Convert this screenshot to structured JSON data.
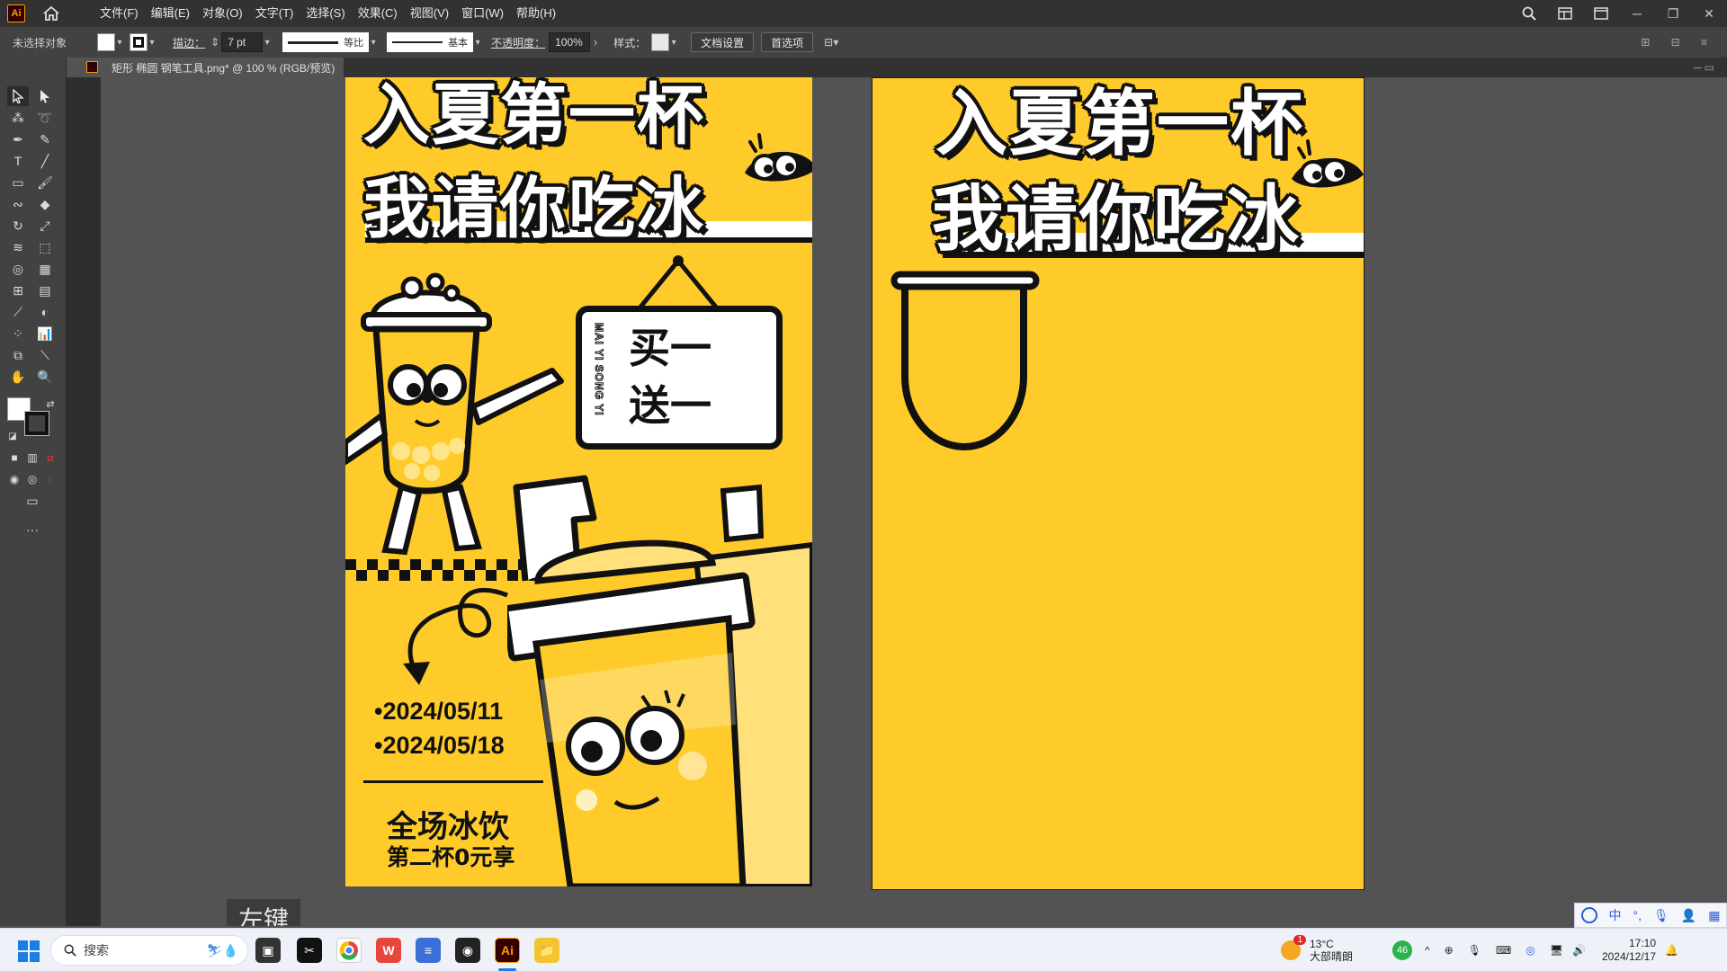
{
  "app": {
    "logo": "Ai",
    "menus": [
      "文件(F)",
      "编辑(E)",
      "对象(O)",
      "文字(T)",
      "选择(S)",
      "效果(C)",
      "视图(V)",
      "窗口(W)",
      "帮助(H)"
    ]
  },
  "controlbar": {
    "selection": "未选择对象",
    "stroke_label": "描边：",
    "stroke_value": "7 pt",
    "stroke_profile": "等比",
    "brush": "基本",
    "opacity_label": "不透明度：",
    "opacity_value": "100%",
    "style_label": "样式：",
    "doc_settings": "文档设置",
    "preferences": "首选项"
  },
  "document": {
    "tab_title": "矩形 椭圆 钢笔工具.png* @ 100 % (RGB/预览)"
  },
  "poster": {
    "title_line1": "入夏第一杯",
    "title_line2": "我请你吃冰",
    "sign_vertical": "MAI YI SONG YI",
    "sign_line1": "买一",
    "sign_line2": "送一",
    "date1": "•2024/05/11",
    "date2": "•2024/05/18",
    "promo_line1": "全场冰饮",
    "promo_line2": "第二杯0元享"
  },
  "artboard2": {
    "title_line1": "入夏第一杯",
    "title_line2": "我请你吃冰"
  },
  "overlay": {
    "key_label": "左键"
  },
  "ime": {
    "lang": "中"
  },
  "taskbar": {
    "search_placeholder": "搜索",
    "weather_temp": "13°C",
    "weather_desc": "大部晴朗",
    "weather_badge": "1",
    "battery_badge": "46",
    "time": "17:10",
    "date": "2024/12/17",
    "ai_app": "Ai"
  },
  "colors": {
    "poster_yellow": "#ffcb2b",
    "ink": "#111111",
    "ui_dark": "#323232",
    "ui_mid": "#424242",
    "canvas": "#535353"
  }
}
